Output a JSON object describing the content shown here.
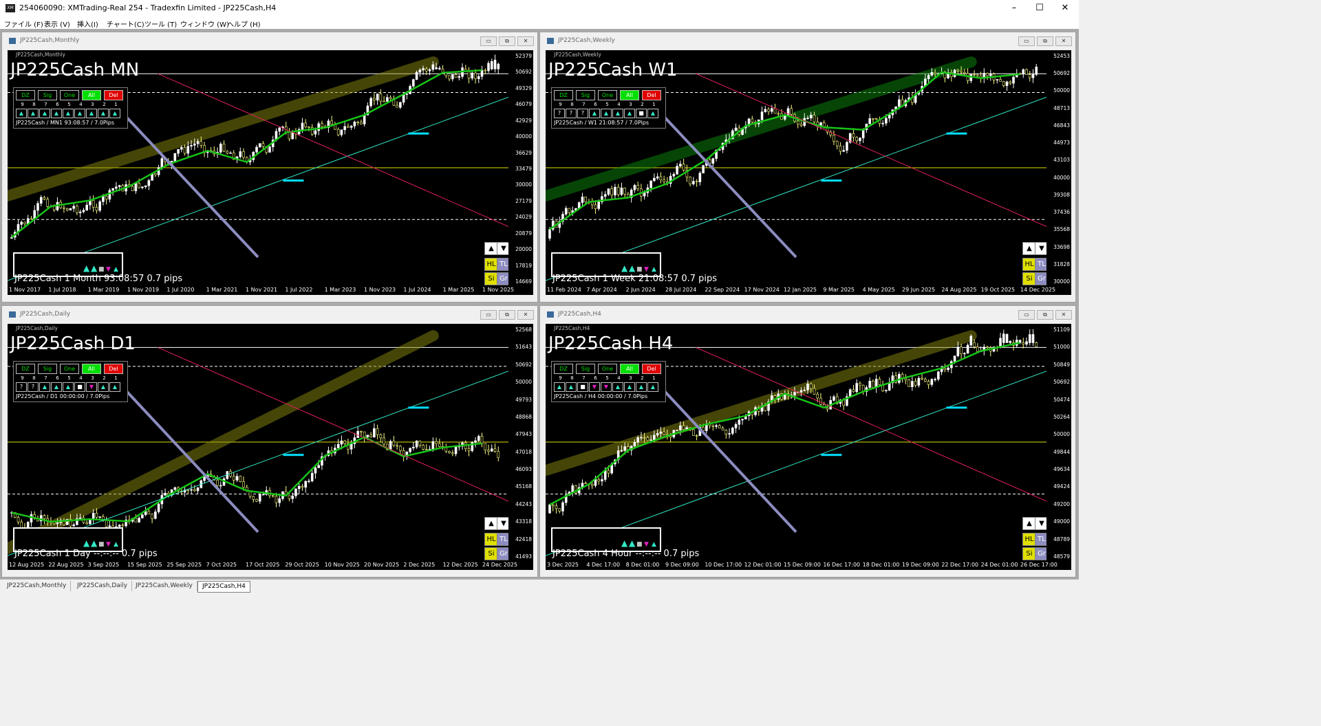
{
  "app": {
    "title": "254060090: XMTrading-Real 254 - Tradexfin Limited - JP225Cash,H4",
    "icon": "xm-logo-icon",
    "window_buttons": [
      "–",
      "☐",
      "✕"
    ]
  },
  "menu": [
    "ファイル (F)",
    "表示 (V)",
    "挿入(I)",
    "チャート(C)",
    "ツール (T)",
    "ウィンドウ (W)",
    "ヘルプ (H)"
  ],
  "window_buttons": {
    "minimize": "▭",
    "restore": "⧉",
    "close": "✕"
  },
  "colors": {
    "background": "#000000",
    "bull_candle": "#ffffff",
    "bear_candle": "#ffff80",
    "zigzag_green": "#17c417",
    "trend_cyan": "#33e8c8",
    "level_yellow": "#e0e000",
    "trend_pink": "#e0205a",
    "zigzag_lavender": "#8c8cc0",
    "level_box_cyan": "#00e0ff"
  },
  "panel_buttons": [
    "DZ",
    "Sig",
    "One",
    "All",
    "Del"
  ],
  "panel_numbers": [
    "9",
    "8",
    "7",
    "6",
    "5",
    "4",
    "3",
    "2",
    "1"
  ],
  "side_buttons": {
    "up": "▲",
    "down": "▼",
    "hl": "HL",
    "tl": "TL",
    "si": "Si",
    "gr": "Gr"
  },
  "charts": [
    {
      "window_title": "JP225Cash,Monthly",
      "symbol": "JP225Cash,Monthly",
      "big_title": "JP225Cash MN",
      "panel_cells": [
        "▲",
        "▲",
        "▲",
        "▲",
        "▲",
        "▲",
        "▲",
        "▲",
        "▲"
      ],
      "panel_info": "JP225Cash / MN1 93:08:57 / 7.0Pips",
      "footer": "JP225Cash   1 Month  93:08:57  0.7 pips",
      "x_labels": [
        "1 Nov 2017",
        "1 Jul 2018",
        "1 Mar 2019",
        "1 Nov 2019",
        "1 Jul 2020",
        "1 Mar 2021",
        "1 Nov 2021",
        "1 Jul 2022",
        "1 Mar 2023",
        "1 Nov 2023",
        "1 Jul 2024",
        "1 Mar 2025",
        "1 Nov 2025"
      ],
      "y_labels": [
        "52379",
        "50692",
        "49329",
        "46079",
        "42929",
        "40000",
        "36629",
        "33479",
        "30000",
        "27179",
        "24029",
        "20879",
        "20000",
        "17819",
        "14669"
      ]
    },
    {
      "window_title": "JP225Cash,Weekly",
      "symbol": "JP225Cash,Weekly",
      "big_title": "JP225Cash W1",
      "panel_cells": [
        "?",
        "?",
        "?",
        "▲",
        "▲",
        "▲",
        "▲",
        "■",
        "▲"
      ],
      "panel_info": "JP225Cash / W1 21:08:57 / 7.0Pips",
      "footer": "JP225Cash   1 Week  21:08:57  0.7 pips",
      "x_labels": [
        "11 Feb 2024",
        "7 Apr 2024",
        "2 Jun 2024",
        "28 Jul 2024",
        "22 Sep 2024",
        "17 Nov 2024",
        "12 Jan 2025",
        "9 Mar 2025",
        "4 May 2025",
        "29 Jun 2025",
        "24 Aug 2025",
        "19 Oct 2025",
        "14 Dec 2025"
      ],
      "y_labels": [
        "52453",
        "50692",
        "50000",
        "48713",
        "46843",
        "44973",
        "43103",
        "40000",
        "39308",
        "37436",
        "35568",
        "33698",
        "31828",
        "30000"
      ]
    },
    {
      "window_title": "JP225Cash,Daily",
      "symbol": "JP225Cash,Daily",
      "big_title": "JP225Cash D1",
      "panel_cells": [
        "?",
        "?",
        "▲",
        "▲",
        "▲",
        "■",
        "▼",
        "▲",
        "▲"
      ],
      "panel_info": "JP225Cash / D1 00:00:00 / 7.0Pips",
      "footer": "JP225Cash   1 Day   --:--:--   0.7 pips",
      "x_labels": [
        "12 Aug 2025",
        "22 Aug 2025",
        "3 Sep 2025",
        "15 Sep 2025",
        "25 Sep 2025",
        "7 Oct 2025",
        "17 Oct 2025",
        "29 Oct 2025",
        "10 Nov 2025",
        "20 Nov 2025",
        "2 Dec 2025",
        "12 Dec 2025",
        "24 Dec 2025"
      ],
      "y_labels": [
        "52568",
        "51643",
        "50692",
        "50000",
        "49793",
        "48868",
        "47943",
        "47018",
        "46093",
        "45168",
        "44243",
        "43318",
        "42418",
        "41493"
      ]
    },
    {
      "window_title": "JP225Cash,H4",
      "symbol": "JP225Cash,H4",
      "big_title": "JP225Cash H4",
      "panel_cells": [
        "▲",
        "▲",
        "■",
        "▼",
        "▼",
        "▲",
        "▲",
        "▲",
        "▲"
      ],
      "panel_info": "JP225Cash / H4 00:00:00 / 7.0Pips",
      "footer": "JP225Cash   4 Hour   --:--:--   0.7 pips",
      "x_labels": [
        "3 Dec 2025",
        "4 Dec 17:00",
        "8 Dec 01:00",
        "9 Dec 09:00",
        "10 Dec 17:00",
        "12 Dec 01:00",
        "15 Dec 09:00",
        "16 Dec 17:00",
        "18 Dec 01:00",
        "19 Dec 09:00",
        "22 Dec 17:00",
        "24 Dec 01:00",
        "26 Dec 17:00"
      ],
      "y_labels": [
        "51109",
        "51000",
        "50849",
        "50692",
        "50474",
        "50264",
        "50000",
        "49844",
        "49634",
        "49424",
        "49200",
        "49000",
        "48789",
        "48579"
      ]
    }
  ],
  "tabs": [
    "JP225Cash,Monthly",
    "JP225Cash,Daily",
    "JP225Cash,Weekly",
    "JP225Cash,H4"
  ],
  "active_tab": 3
}
